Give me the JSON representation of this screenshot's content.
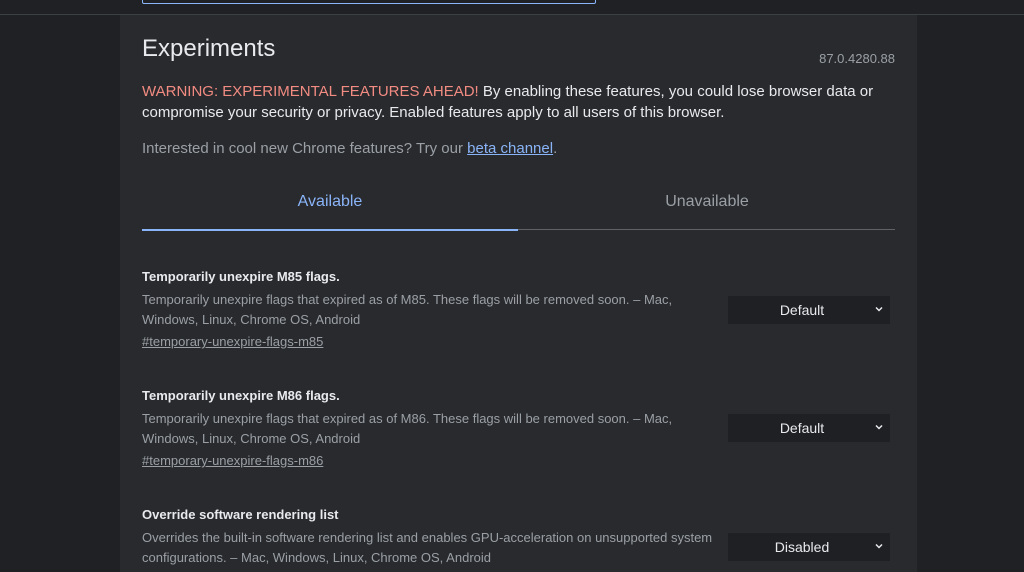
{
  "header": {
    "title": "Experiments",
    "version": "87.0.4280.88"
  },
  "warning": {
    "label": "WARNING: EXPERIMENTAL FEATURES AHEAD!",
    "text": " By enabling these features, you could lose browser data or compromise your security or privacy. Enabled features apply to all users of this browser."
  },
  "promo": {
    "text": "Interested in cool new Chrome features? Try our ",
    "link": "beta channel",
    "suffix": "."
  },
  "tabs": [
    {
      "label": "Available",
      "active": true
    },
    {
      "label": "Unavailable",
      "active": false
    }
  ],
  "flags": [
    {
      "name": "Temporarily unexpire M85 flags.",
      "description": "Temporarily unexpire flags that expired as of M85. These flags will be removed soon. – Mac, Windows, Linux, Chrome OS, Android",
      "link": "#temporary-unexpire-flags-m85",
      "value": "Default"
    },
    {
      "name": "Temporarily unexpire M86 flags.",
      "description": "Temporarily unexpire flags that expired as of M86. These flags will be removed soon. – Mac, Windows, Linux, Chrome OS, Android",
      "link": "#temporary-unexpire-flags-m86",
      "value": "Default"
    },
    {
      "name": "Override software rendering list",
      "description": "Overrides the built-in software rendering list and enables GPU-acceleration on unsupported system configurations. – Mac, Windows, Linux, Chrome OS, Android",
      "link": "",
      "value": "Disabled"
    }
  ],
  "colors": {
    "background": "#202124",
    "panel": "#292a2d",
    "accent": "#8ab4f8",
    "warning": "#f28b82"
  }
}
